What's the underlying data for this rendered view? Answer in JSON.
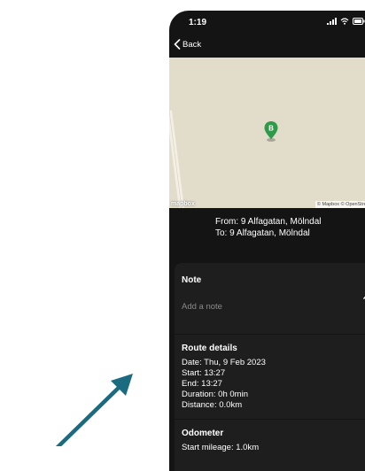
{
  "status": {
    "time": "1:19"
  },
  "nav": {
    "back_label": "Back"
  },
  "map": {
    "marker_label": "B",
    "logo_text": "mapbox",
    "attribution": "© Mapbox © OpenStreetMap"
  },
  "route": {
    "from": "From: 9 Alfagatan, Mölndal",
    "to": "To: 9 Alfagatan, Mölndal"
  },
  "note": {
    "title": "Note",
    "placeholder": "Add a note"
  },
  "route_details": {
    "title": "Route details",
    "lines": [
      "Date: Thu, 9 Feb 2023",
      "Start: 13:27",
      "End: 13:27",
      "Duration: 0h 0min",
      "Distance: 0.0km"
    ]
  },
  "odometer": {
    "title": "Odometer",
    "start": "Start mileage: 1.0km"
  },
  "colors": {
    "background": "#141414",
    "card": "#1e1e1e",
    "map": "#e2dccb",
    "marker": "#2e9a4a",
    "arrow": "#1a6b80"
  },
  "icons": [
    "back-chevron-icon",
    "signal-icon",
    "wifi-icon",
    "battery-icon",
    "map-marker-icon",
    "pencil-icon",
    "arrow-icon"
  ]
}
